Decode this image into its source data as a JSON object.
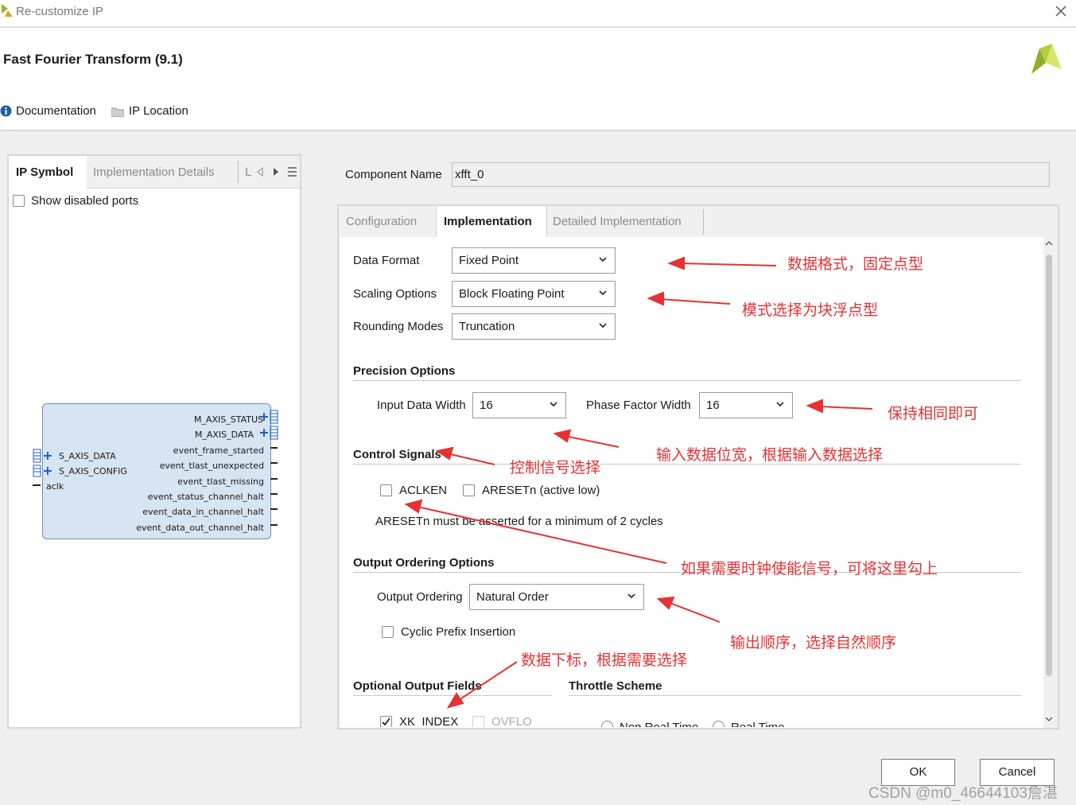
{
  "window": {
    "title": "Re-customize IP"
  },
  "header": {
    "ip_title": "Fast Fourier Transform (9.1)",
    "doc_link": "Documentation",
    "location_link": "IP Location"
  },
  "left_panel": {
    "tabs": [
      "IP Symbol",
      "Implementation Details",
      "L"
    ],
    "show_disabled_label": "Show disabled ports",
    "left_ports": [
      "S_AXIS_DATA",
      "S_AXIS_CONFIG",
      "aclk"
    ],
    "right_ports": [
      "M_AXIS_STATUS",
      "M_AXIS_DATA",
      "event_frame_started",
      "event_tlast_unexpected",
      "event_tlast_missing",
      "event_status_channel_halt",
      "event_data_in_channel_halt",
      "event_data_out_channel_halt"
    ]
  },
  "component": {
    "label": "Component Name",
    "value": "xfft_0"
  },
  "tabs": [
    "Configuration",
    "Implementation",
    "Detailed Implementation"
  ],
  "impl": {
    "data_format": {
      "label": "Data Format",
      "value": "Fixed Point"
    },
    "scaling": {
      "label": "Scaling Options",
      "value": "Block Floating Point"
    },
    "rounding": {
      "label": "Rounding Modes",
      "value": "Truncation"
    },
    "precision": {
      "title": "Precision Options",
      "input_label": "Input Data Width",
      "input_value": "16",
      "phase_label": "Phase Factor Width",
      "phase_value": "16"
    },
    "control": {
      "title": "Control Signals",
      "aclken": "ACLKEN",
      "aresetn": "ARESETn (active low)",
      "note": "ARESETn must be asserted for a minimum of 2 cycles"
    },
    "output": {
      "title": "Output Ordering Options",
      "ordering_label": "Output Ordering",
      "ordering_value": "Natural Order",
      "cyclic": "Cyclic Prefix Insertion"
    },
    "optional": {
      "title": "Optional Output Fields",
      "xk_index": "XK_INDEX",
      "ovflo": "OVFLO"
    },
    "throttle": {
      "title": "Throttle Scheme",
      "non_real": "Non Real Time",
      "real": "Real Time"
    }
  },
  "annotations": [
    "数据格式，固定点型",
    "模式选择为块浮点型",
    "保持相同即可",
    "控制信号选择",
    "输入数据位宽，根据输入数据选择",
    "如果需要时钟使能信号，可将这里勾上",
    "输出顺序，选择自然顺序",
    "数据下标，根据需要选择"
  ],
  "buttons": {
    "ok": "OK",
    "cancel": "Cancel"
  },
  "watermark": "CSDN @m0_46644103詹湛",
  "colors": {
    "annotation": "#e53232",
    "ip_block": "#d7e4f1",
    "port_blue": "#1f5fc4"
  }
}
